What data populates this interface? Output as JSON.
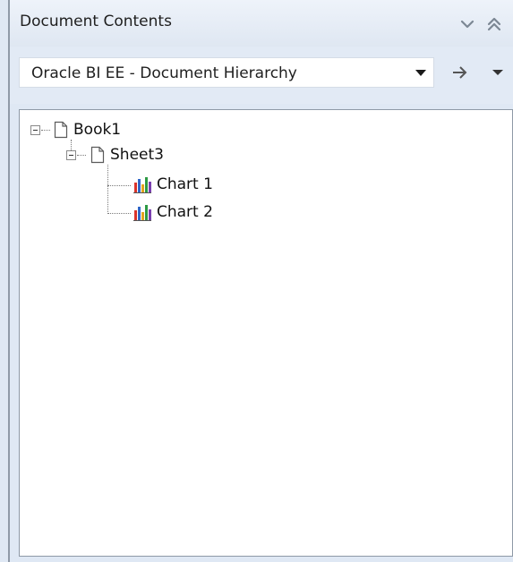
{
  "header": {
    "title": "Document Contents",
    "collapse_icon": "chevron-down-icon",
    "expand_icon": "double-chevron-up-icon"
  },
  "toolbar": {
    "selector_value": "Oracle BI EE - Document Hierarchy",
    "go_icon": "arrow-right-icon",
    "menu_icon": "caret-down-icon"
  },
  "tree": {
    "root": {
      "label": "Book1",
      "icon": "document-icon",
      "expanded": true
    },
    "sheet": {
      "label": "Sheet3",
      "icon": "document-icon",
      "expanded": true
    },
    "charts": [
      {
        "label": "Chart 1",
        "icon": "bar-chart-icon"
      },
      {
        "label": "Chart 2",
        "icon": "bar-chart-icon"
      }
    ]
  },
  "colors": {
    "panel_bg": "#dfe8f4",
    "tree_bg": "#ffffff",
    "border": "#8e99a6"
  }
}
